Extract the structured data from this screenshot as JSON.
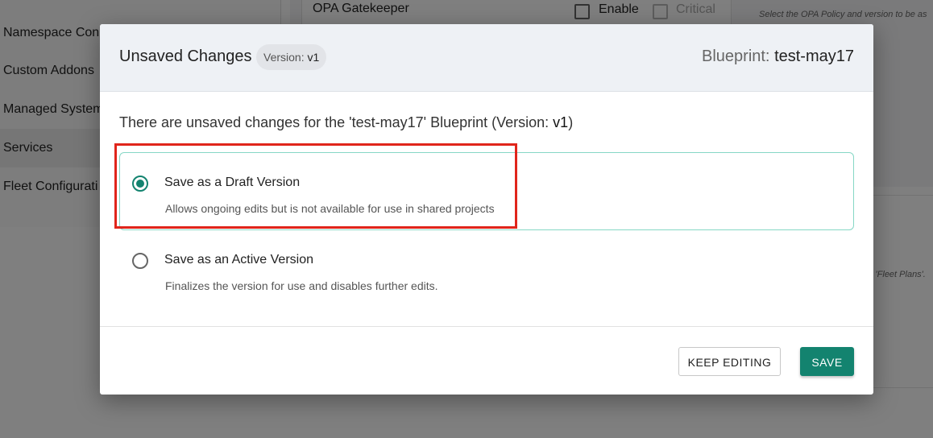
{
  "background": {
    "sidebar_items": [
      {
        "label": "Namespace Con"
      },
      {
        "label": "Custom Addons"
      },
      {
        "label": "Managed System"
      },
      {
        "label": "Services"
      },
      {
        "label": "Fleet Configurati"
      }
    ],
    "opa": {
      "title": "OPA Gatekeeper",
      "enable_label": "Enable",
      "critical_label": "Critical",
      "hint": "Select the OPA Policy and version to be as"
    },
    "fleet_hint": "y 'Fleet Plans'."
  },
  "modal": {
    "title": "Unsaved Changes",
    "version_chip": {
      "label": "Version:",
      "value": "v1"
    },
    "blueprint": {
      "label": "Blueprint:",
      "name": "test-may17"
    },
    "description": {
      "text": "There are unsaved changes for the 'test-may17' Blueprint (Version: ",
      "version": "v1",
      "suffix": ")"
    },
    "options": [
      {
        "title": "Save as a Draft Version",
        "subtitle": "Allows ongoing edits but is not available for use in shared projects",
        "selected": true
      },
      {
        "title": "Save as an Active Version",
        "subtitle": "Finalizes the version for use and disables further edits.",
        "selected": false
      }
    ],
    "buttons": {
      "keep_editing": "KEEP EDITING",
      "save": "SAVE"
    }
  },
  "colors": {
    "accent": "#13836f",
    "selected_border": "#86d7c5",
    "highlight": "#e0251b",
    "overlay": "rgba(0,0,0,0.5)"
  }
}
